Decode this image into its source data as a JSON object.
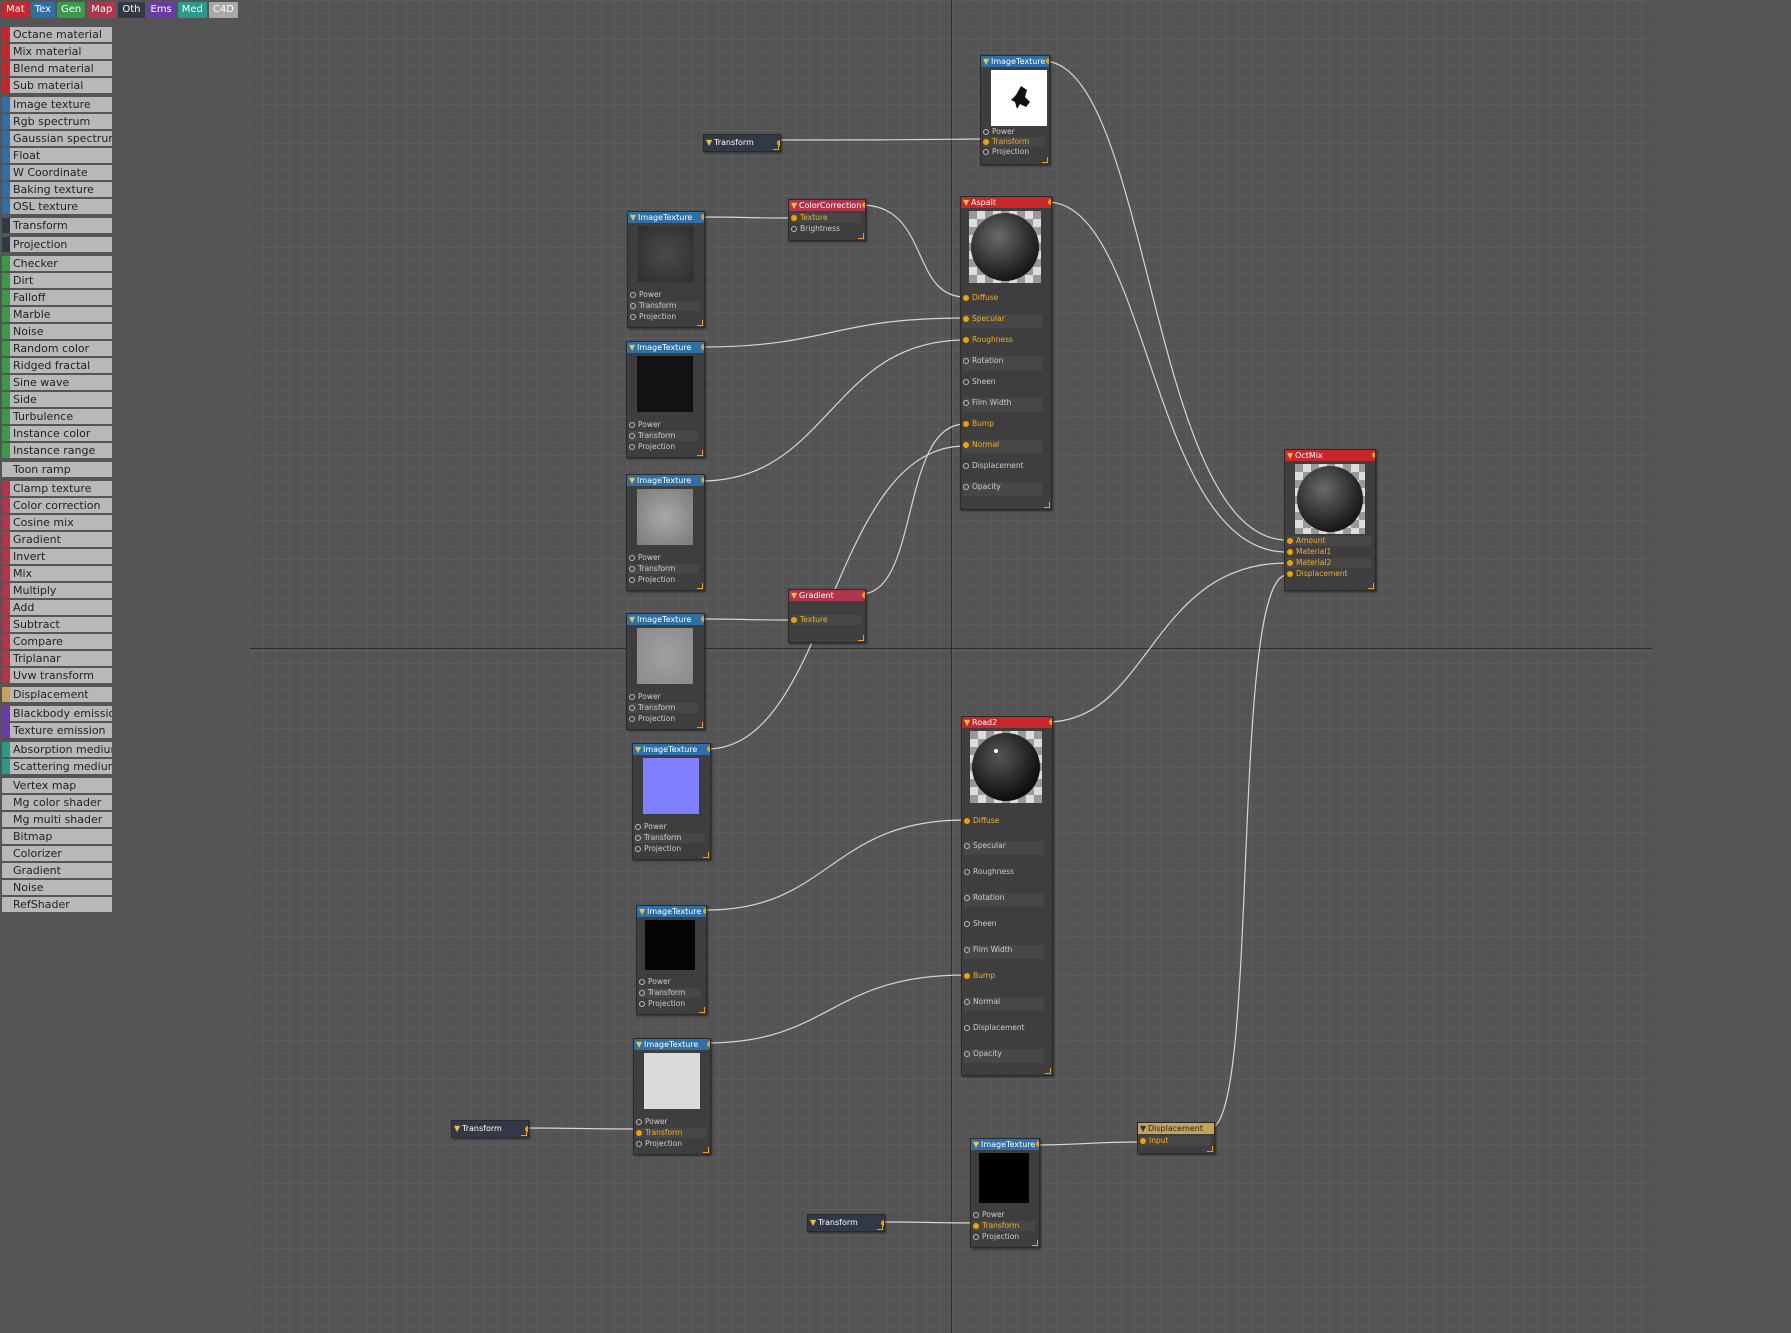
{
  "tabs": [
    {
      "label": "Mat",
      "color": "#c8262b"
    },
    {
      "label": "Tex",
      "color": "#2f6fa8"
    },
    {
      "label": "Gen",
      "color": "#3a9a4a"
    },
    {
      "label": "Map",
      "color": "#b2344a"
    },
    {
      "label": "Oth",
      "color": "#323846"
    },
    {
      "label": "Ems",
      "color": "#6a3aa8"
    },
    {
      "label": "Med",
      "color": "#2a9a8a"
    },
    {
      "label": "C4D",
      "color": "#a8a8a8"
    }
  ],
  "sidebar": {
    "groups": [
      {
        "color": "#c8262b",
        "items": [
          "Octane material",
          "Mix material",
          "Blend material",
          "Sub material"
        ]
      },
      {
        "color": "#2f6fa8",
        "items": [
          "Image texture",
          "Rgb spectrum",
          "Gaussian spectrum",
          "Float",
          "W Coordinate",
          "Baking texture",
          "OSL texture"
        ]
      },
      {
        "color": "#323846",
        "items": [
          "Transform"
        ]
      },
      {
        "color": "#323846",
        "items": [
          "Projection"
        ]
      },
      {
        "color": "#3a9a4a",
        "items": [
          "Checker",
          "Dirt",
          "Falloff",
          "Marble",
          "Noise",
          "Random color",
          "Ridged fractal",
          "Sine wave",
          "Side",
          "Turbulence",
          "Instance color",
          "Instance range"
        ]
      },
      {
        "color": "#b8b8b8",
        "items": [
          "Toon ramp"
        ]
      },
      {
        "color": "#b2344a",
        "items": [
          "Clamp texture",
          "Color correction",
          "Cosine mix",
          "Gradient",
          "Invert",
          "Mix",
          "Multiply",
          "Add",
          "Subtract",
          "Compare",
          "Triplanar",
          "Uvw transform"
        ]
      },
      {
        "color": "#c2a35a",
        "items": [
          "Displacement"
        ]
      },
      {
        "color": "#6a3aa8",
        "items": [
          "Blackbody emission",
          "Texture emission"
        ]
      },
      {
        "color": "#2a9a8a",
        "items": [
          "Absorption medium",
          "Scattering medium"
        ]
      },
      {
        "color": "#b8b8b8",
        "items": [
          "Vertex map",
          "Mg color shader",
          "Mg multi shader",
          "Bitmap",
          "Colorizer",
          "Gradient",
          "Noise",
          "RefShader"
        ]
      }
    ]
  },
  "nodes": {
    "img_top": {
      "title": "ImageTexture",
      "pins": [
        "Power",
        "Transform",
        "Projection"
      ]
    },
    "trans_top": {
      "title": "Transform"
    },
    "cc": {
      "title": "ColorCorrection",
      "pins": [
        "Texture",
        "Brightness"
      ]
    },
    "img1": {
      "title": "ImageTexture",
      "pins": [
        "Power",
        "Transform",
        "Projection"
      ]
    },
    "img2": {
      "title": "ImageTexture",
      "pins": [
        "Power",
        "Transform",
        "Projection"
      ]
    },
    "img3": {
      "title": "ImageTexture",
      "pins": [
        "Power",
        "Transform",
        "Projection"
      ]
    },
    "img4": {
      "title": "ImageTexture",
      "pins": [
        "Power",
        "Transform",
        "Projection"
      ]
    },
    "grad": {
      "title": "Gradient",
      "pins": [
        "Texture"
      ]
    },
    "img5": {
      "title": "ImageTexture",
      "pins": [
        "Power",
        "Transform",
        "Projection"
      ]
    },
    "asphalt": {
      "title": "Aspalt",
      "pins": [
        "Diffuse",
        "Specular",
        "Roughness",
        "Rotation",
        "Sheen",
        "Film Width",
        "Bump",
        "Normal",
        "Displacement",
        "Opacity"
      ]
    },
    "octmix": {
      "title": "OctMix",
      "pins": [
        "Amount",
        "Material1",
        "Material2",
        "Displacement"
      ]
    },
    "road": {
      "title": "Road2",
      "pins": [
        "Diffuse",
        "Specular",
        "Roughness",
        "Rotation",
        "Sheen",
        "Film Width",
        "Bump",
        "Normal",
        "Displacement",
        "Opacity"
      ]
    },
    "img6": {
      "title": "ImageTexture",
      "pins": [
        "Power",
        "Transform",
        "Projection"
      ]
    },
    "img7": {
      "title": "ImageTexture",
      "pins": [
        "Power",
        "Transform",
        "Projection"
      ]
    },
    "trans_bl": {
      "title": "Transform"
    },
    "img8": {
      "title": "ImageTexture",
      "pins": [
        "Power",
        "Transform",
        "Projection"
      ]
    },
    "trans_bm": {
      "title": "Transform"
    },
    "disp": {
      "title": "Displacement",
      "pins": [
        "Input"
      ]
    }
  }
}
